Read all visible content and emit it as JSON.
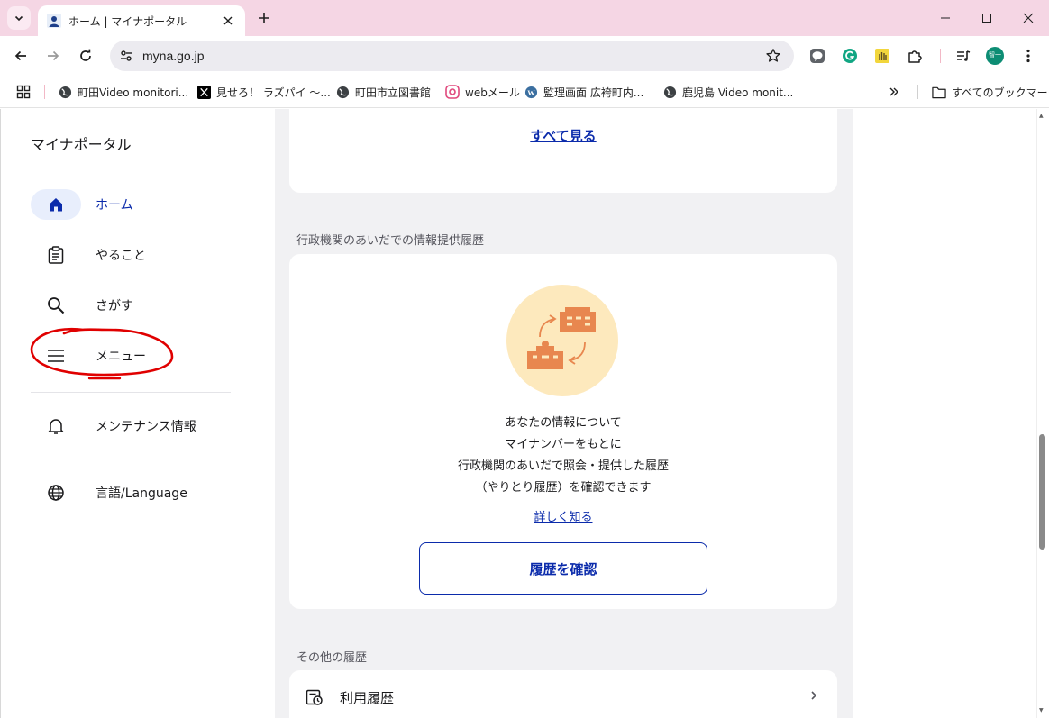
{
  "browser": {
    "tab": {
      "title": "ホーム | マイナポータル",
      "favicon": "person-icon"
    },
    "url": "myna.go.jp",
    "profile_initial": "智一",
    "bookmarks": [
      {
        "label": "町田Video monitori...",
        "icon": "globe-icon"
      },
      {
        "label": "見せろ！ ラズパイ 〜...",
        "icon": "x-icon"
      },
      {
        "label": "町田市立図書館",
        "icon": "globe-icon"
      },
      {
        "label": "webメール",
        "icon": "mail-icon"
      },
      {
        "label": "監理画面 広袴町内...",
        "icon": "wordpress-icon"
      },
      {
        "label": "鹿児島 Video monit...",
        "icon": "globe-icon"
      }
    ],
    "all_bookmarks_label": "すべてのブックマーク"
  },
  "sidebar": {
    "brand": "マイナポータル",
    "items": [
      {
        "label": "ホーム",
        "icon": "home-icon",
        "active": true
      },
      {
        "label": "やること",
        "icon": "clipboard-icon",
        "active": false
      },
      {
        "label": "さがす",
        "icon": "search-icon",
        "active": false
      },
      {
        "label": "メニュー",
        "icon": "menu-icon",
        "active": false
      },
      {
        "label": "メンテナンス情報",
        "icon": "bell-icon",
        "active": false
      },
      {
        "label": "言語/Language",
        "icon": "globe-icon",
        "active": false
      }
    ]
  },
  "main": {
    "see_all_link": "すべて見る",
    "history_section": {
      "heading": "行政機関のあいだでの情報提供履歴",
      "description_lines": [
        "あなたの情報について",
        "マイナンバーをもとに",
        "行政機関のあいだで照会・提供した履歴",
        "（やりとり履歴）を確認できます"
      ],
      "learn_more_link": "詳しく知る",
      "check_button": "履歴を確認"
    },
    "other_section": {
      "heading": "その他の履歴",
      "items": [
        {
          "label": "利用履歴",
          "icon": "usage-history-icon"
        }
      ]
    }
  },
  "colors": {
    "accent": "#0b2bab",
    "active_nav_bg": "#e8eefc",
    "tab_strip": "#f5d6e4",
    "illustration_bg": "#fde9bd",
    "illustration_fg": "#e8874f",
    "annotation": "#e00000"
  }
}
